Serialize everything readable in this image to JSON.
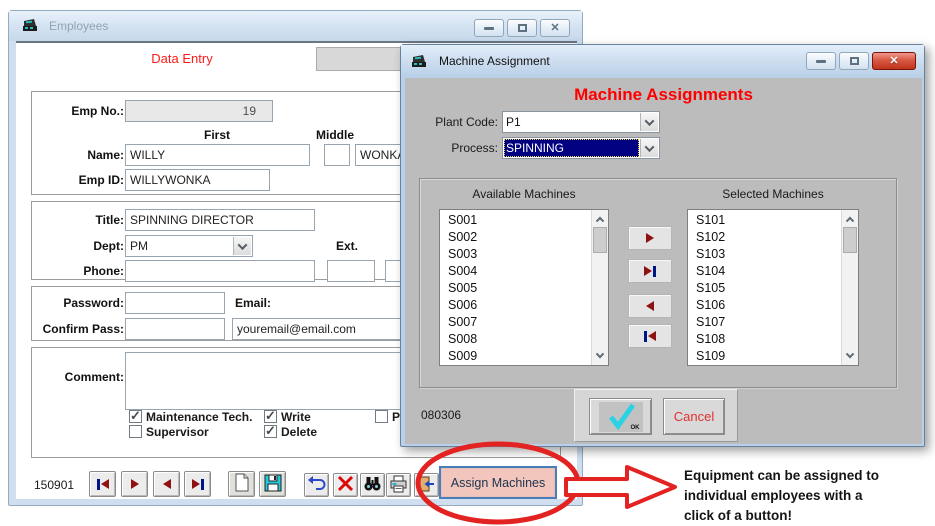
{
  "colors": {
    "accent_red": "#ff0000",
    "selection_navy": "#000080",
    "assign_button_pink": "#f2c6bd",
    "assign_button_border_blue": "#4a7ebb",
    "annotation_red": "#e32222",
    "arrow_dark_red": "#8e1212",
    "bar_navy": "#001489",
    "dialog_gray": "#bcbcbc"
  },
  "employees_window": {
    "title": "Employees",
    "tab_label": "Data Entry",
    "emp_no_label": "Emp No.:",
    "emp_no_value": "19",
    "first_header": "First",
    "middle_header": "Middle",
    "name_label": "Name:",
    "first_name": "WILLY",
    "middle_name": "",
    "last_name": "WONKA",
    "emp_id_label": "Emp ID:",
    "emp_id_value": "WILLYWONKA",
    "title_label": "Title:",
    "title_value": "SPINNING DIRECTOR",
    "dept_label": "Dept:",
    "dept_value": "PM",
    "ext_label": "Ext.",
    "phone_label": "Phone:",
    "phone_value": "",
    "password_label": "Password:",
    "password_value": "",
    "email_label": "Email:",
    "confirm_pass_label": "Confirm Pass:",
    "confirm_pass_value": "",
    "email_value": "youremail@email.com",
    "comment_label": "Comment:",
    "comment_value": "",
    "checkboxes": [
      {
        "label": "Maintenance Tech.",
        "checked": true
      },
      {
        "label": "Supervisor",
        "checked": false
      },
      {
        "label": "Write",
        "checked": true
      },
      {
        "label": "Delete",
        "checked": true
      },
      {
        "label": "Pack",
        "checked": false
      }
    ],
    "record_number": "150901",
    "assign_machines_label": "Assign Machines"
  },
  "dialog": {
    "title": "Machine Assignment",
    "heading": "Machine Assignments",
    "plant_code_label": "Plant Code:",
    "plant_code_value": "P1",
    "process_label": "Process:",
    "process_value": "SPINNING",
    "available_label": "Available Machines",
    "selected_label": "Selected Machines",
    "available_machines": [
      "S001",
      "S002",
      "S003",
      "S004",
      "S005",
      "S006",
      "S007",
      "S008",
      "S009"
    ],
    "selected_machines": [
      "S101",
      "S102",
      "S103",
      "S104",
      "S105",
      "S106",
      "S107",
      "S108",
      "S109"
    ],
    "version": "080306",
    "ok_label": "OK",
    "cancel_label": "Cancel"
  },
  "annotation": {
    "lines": [
      "Equipment can be assigned to",
      "individual employees with a",
      "click of a button!"
    ]
  }
}
